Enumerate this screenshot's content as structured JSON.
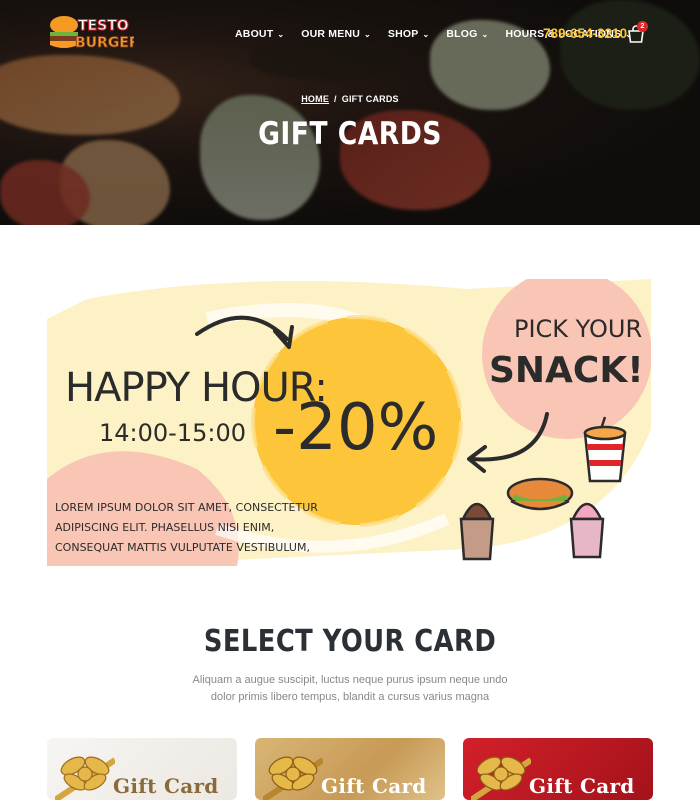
{
  "header": {
    "logo_top": "TESTO",
    "logo_bottom": "BURGER",
    "nav": [
      {
        "label": "ABOUT",
        "has_dropdown": true
      },
      {
        "label": "OUR MENU",
        "has_dropdown": true
      },
      {
        "label": "SHOP",
        "has_dropdown": true
      },
      {
        "label": "BLOG",
        "has_dropdown": true
      },
      {
        "label": "HOURS & LOCATIONS",
        "has_dropdown": true
      }
    ],
    "phone": "789-654-3210",
    "cart_count": "2",
    "cart_icon": "shopping-bag-icon"
  },
  "hero": {
    "breadcrumb_home": "HOME",
    "breadcrumb_separator": "/",
    "breadcrumb_current": "GIFT CARDS",
    "title": "GIFT CARDS"
  },
  "promo": {
    "happy_hour": "HAPPY HOUR:",
    "time": "14:00-15:00",
    "discount": "-20%",
    "pick_line1": "PICK YOUR",
    "pick_line2": "SNACK!",
    "body_lines": [
      "LOREM IPSUM DOLOR SIT AMET, CONSECTETUR",
      "ADIPISCING ELIT. PHASELLUS NISI ENIM,",
      "CONSEQUAT MATTIS VULPUTATE VESTIBULUM,"
    ]
  },
  "select_section": {
    "title": "SELECT YOUR CARD",
    "subtitle_line1": "Aliquam a augue suscipit, luctus neque purus ipsum neque undo",
    "subtitle_line2": "dolor primis libero tempus, blandit a cursus varius magna"
  },
  "cards": [
    {
      "label": "Gift Card",
      "style": "white",
      "text_color": "#8a6a3a"
    },
    {
      "label": "Gift Card",
      "style": "gold",
      "text_color": "#ffffff"
    },
    {
      "label": "Gift Card",
      "style": "red",
      "text_color": "#ffffff"
    }
  ],
  "colors": {
    "accent_yellow": "#ffc233",
    "badge_red": "#e0262b",
    "promo_circle": "#fcc53a",
    "promo_peach": "#f9c5b4",
    "promo_cream": "#fdf1c6"
  }
}
